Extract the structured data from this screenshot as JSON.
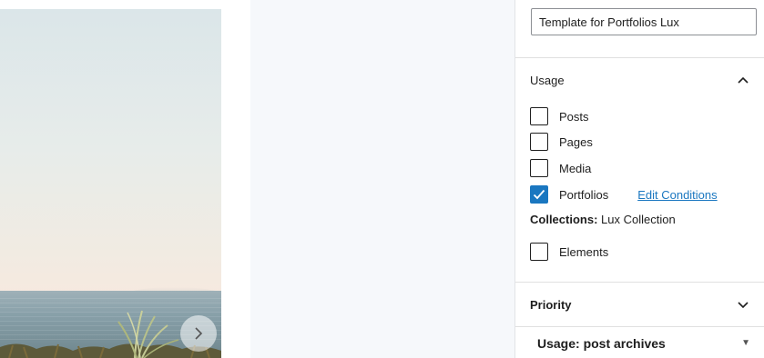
{
  "template_title": "Template for Portfolios Lux",
  "usage": {
    "title": "Usage",
    "options": [
      {
        "label": "Posts",
        "checked": false
      },
      {
        "label": "Pages",
        "checked": false
      },
      {
        "label": "Media",
        "checked": false
      },
      {
        "label": "Portfolios",
        "checked": true
      },
      {
        "label": "Elements",
        "checked": false
      }
    ],
    "edit_conditions_label": "Edit Conditions",
    "collections_label": "Collections:",
    "collections_value": " Lux Collection"
  },
  "priority": {
    "title": "Priority"
  },
  "archives": {
    "title": "Usage: post archives"
  },
  "colors": {
    "accent": "#1a77c0",
    "canvas": "#f6f8fb"
  },
  "icons": {
    "carousel": "chevron-right-icon",
    "usage_toggle": "chevron-up-icon",
    "priority_toggle": "chevron-down-icon",
    "archives_toggle": "triangle-down-icon"
  }
}
